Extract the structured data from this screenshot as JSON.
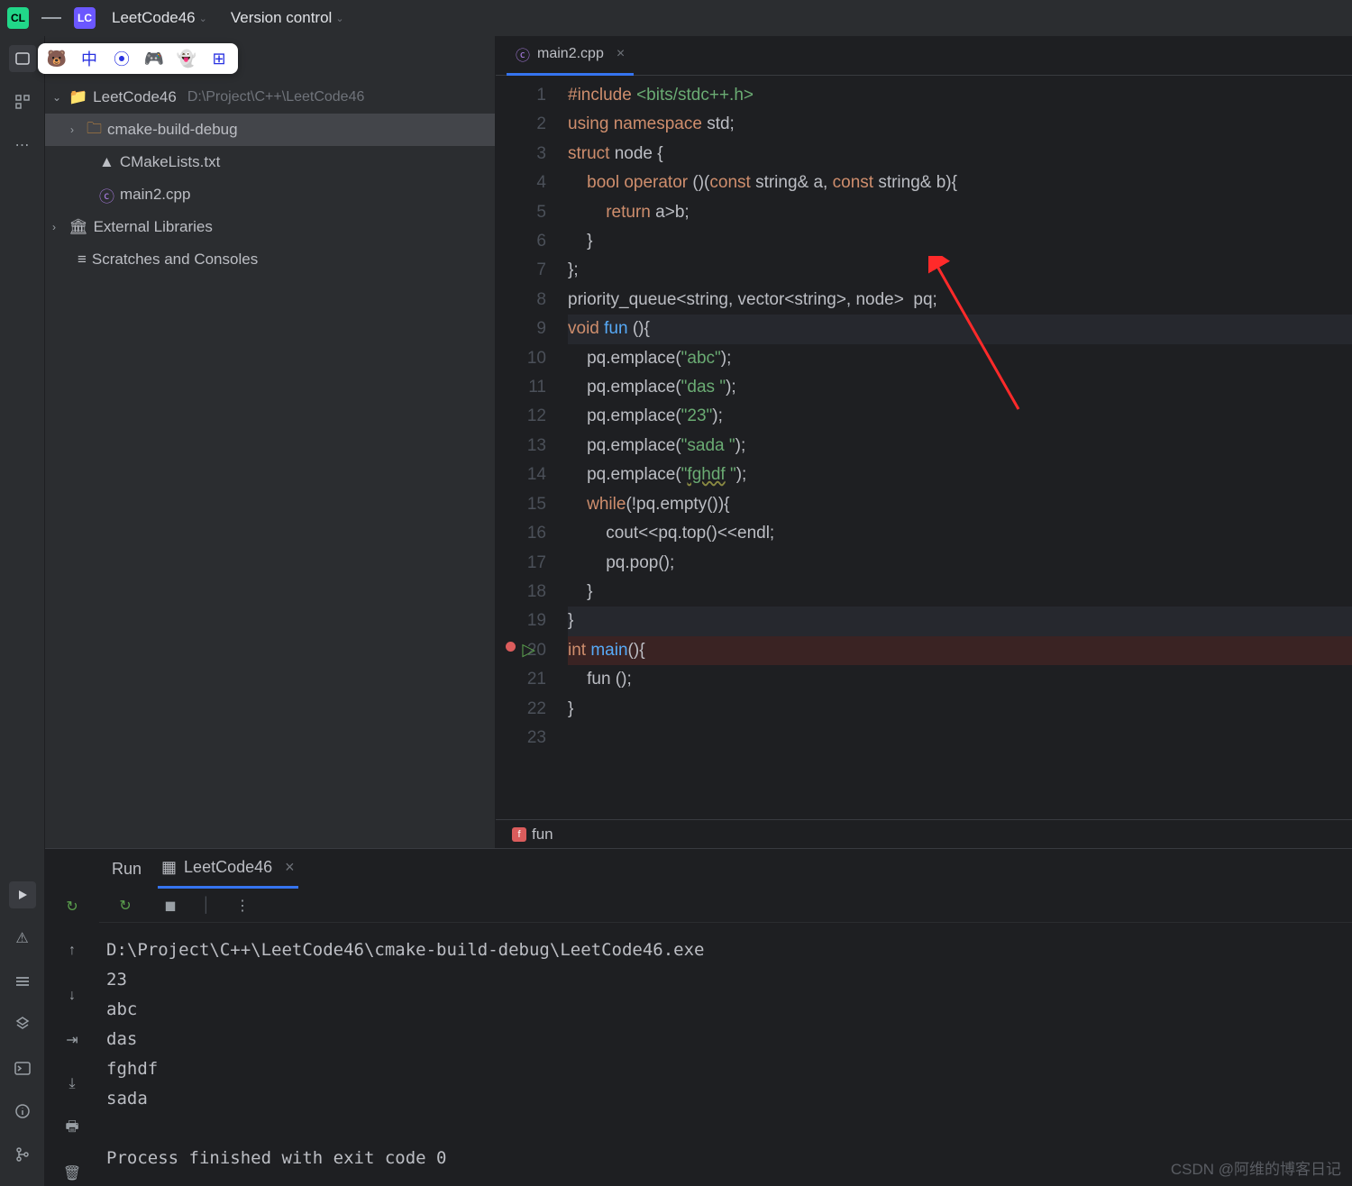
{
  "header": {
    "app_badge": "CL",
    "project_badge": "LC",
    "project_name": "LeetCode46",
    "version_control": "Version control"
  },
  "project_tree": {
    "root_name": "LeetCode46",
    "root_path": "D:\\Project\\C++\\LeetCode46",
    "items": [
      {
        "label": "cmake-build-debug",
        "kind": "folder",
        "expandable": true
      },
      {
        "label": "CMakeLists.txt",
        "kind": "cmake"
      },
      {
        "label": "main2.cpp",
        "kind": "cpp"
      }
    ],
    "external": "External Libraries",
    "scratches": "Scratches and Consoles"
  },
  "editor": {
    "tab_label": "main2.cpp",
    "breadcrumb": "fun",
    "code_lines": [
      {
        "n": 1,
        "html": "<span class='kw'>#include</span> <span class='str'>&lt;bits/stdc++.h&gt;</span>"
      },
      {
        "n": 2,
        "html": "<span class='kw'>using namespace</span> std;"
      },
      {
        "n": 3,
        "html": "<span class='kw'>struct</span> node {"
      },
      {
        "n": 4,
        "html": "    <span class='kw'>bool</span> <span class='kw'>operator</span> ()(<span class='kw'>const</span> string&amp; a, <span class='kw'>const</span> string&amp; b){"
      },
      {
        "n": 5,
        "html": "        <span class='kw'>return</span> a&gt;b;"
      },
      {
        "n": 6,
        "html": "    }"
      },
      {
        "n": 7,
        "html": "};"
      },
      {
        "n": 8,
        "html": "priority_queue&lt;string, vector&lt;string&gt;, node&gt;  pq;"
      },
      {
        "n": 9,
        "html": "<span class='kw'>void</span> <span class='fn'>fun</span> (){",
        "cls": "hl-line"
      },
      {
        "n": 10,
        "html": "    pq.emplace(<span class='str'>\"abc\"</span>);"
      },
      {
        "n": 11,
        "html": "    pq.emplace(<span class='str'>\"das \"</span>);"
      },
      {
        "n": 12,
        "html": "    pq.emplace(<span class='str'>\"23\"</span>);"
      },
      {
        "n": 13,
        "html": "    pq.emplace(<span class='str'>\"sada \"</span>);"
      },
      {
        "n": 14,
        "html": "    pq.emplace(<span class='str'>\"<span class='wavy'>fghdf</span> \"</span>);"
      },
      {
        "n": 15,
        "html": "    <span class='kw'>while</span>(!pq.empty()){"
      },
      {
        "n": 16,
        "html": "        cout&lt;&lt;pq.top()&lt;&lt;endl;"
      },
      {
        "n": 17,
        "html": "        pq.pop();"
      },
      {
        "n": 18,
        "html": "    }"
      },
      {
        "n": 19,
        "html": "}",
        "cls": "hl-line"
      },
      {
        "n": 20,
        "html": "<span class='kw'>int</span> <span class='fn'>main</span>(){",
        "cls": "bp-line",
        "breakpoint": true,
        "run": true
      },
      {
        "n": 21,
        "html": "    fun ();"
      },
      {
        "n": 22,
        "html": "}"
      },
      {
        "n": 23,
        "html": ""
      }
    ]
  },
  "run": {
    "title": "Run",
    "config": "LeetCode46",
    "output": "D:\\Project\\C++\\LeetCode46\\cmake-build-debug\\LeetCode46.exe\n23\nabc\ndas\nfghdf\nsada\n\nProcess finished with exit code 0"
  },
  "watermark": "CSDN @阿维的博客日记"
}
